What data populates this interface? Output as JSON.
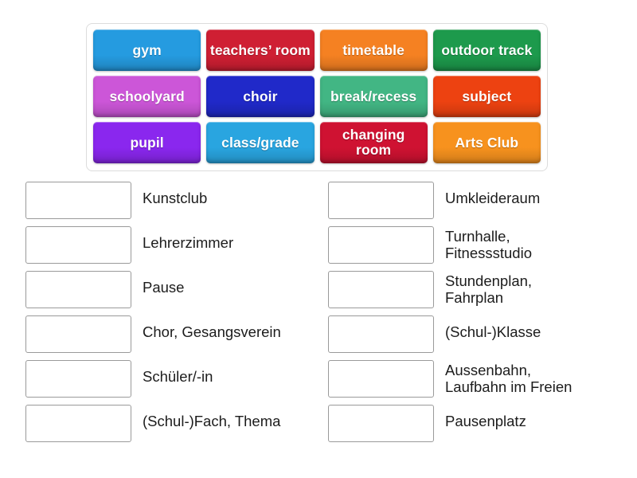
{
  "activity": {
    "type": "match-up",
    "title": "",
    "tile_rows": [
      [
        {
          "label": "gym",
          "color": "#259be0"
        },
        {
          "label": "teachers’\nroom",
          "color": "#cf1f33"
        },
        {
          "label": "timetable",
          "color": "#f58122"
        },
        {
          "label": "outdoor\ntrack",
          "color": "#1d9a4c"
        }
      ],
      [
        {
          "label": "schoolyard",
          "color": "#cc56d8"
        },
        {
          "label": "choir",
          "color": "#2029c9"
        },
        {
          "label": "break/recess",
          "color": "#42b684"
        },
        {
          "label": "subject",
          "color": "#ed4211"
        }
      ],
      [
        {
          "label": "pupil",
          "color": "#8a27ee"
        },
        {
          "label": "class/grade",
          "color": "#29a5e0"
        },
        {
          "label": "changing\nroom",
          "color": "#cf1232"
        },
        {
          "label": "Arts Club",
          "color": "#f7921e"
        }
      ]
    ],
    "answers_left": [
      {
        "label": "Kunstclub",
        "lines": 1,
        "box_value": ""
      },
      {
        "label": "Lehrerzimmer",
        "lines": 1,
        "box_value": ""
      },
      {
        "label": "Pause",
        "lines": 1,
        "box_value": ""
      },
      {
        "label": "Chor, Gesangsverein",
        "lines": 1,
        "box_value": ""
      },
      {
        "label": "Schüler/-in",
        "lines": 1,
        "box_value": ""
      },
      {
        "label": "(Schul-)Fach, Thema",
        "lines": 1,
        "box_value": ""
      }
    ],
    "answers_right": [
      {
        "label": "Umkleideraum",
        "lines": 1,
        "box_value": ""
      },
      {
        "label": "Turnhalle,\nFitnessstudio",
        "lines": 2,
        "box_value": ""
      },
      {
        "label": "Stundenplan,\nFahrplan",
        "lines": 2,
        "box_value": ""
      },
      {
        "label": "(Schul-)Klasse",
        "lines": 1,
        "box_value": ""
      },
      {
        "label": "Aussenbahn,\nLaufbahn im Freien",
        "lines": 2,
        "box_value": ""
      },
      {
        "label": "Pausenplatz",
        "lines": 1,
        "box_value": ""
      }
    ],
    "colors": {
      "page_background": "#ffffff",
      "bank_border": "#dcdcdc",
      "box_border": "#9a9a9a",
      "label_text": "#1c1c1c",
      "tile_text": "#ffffff"
    }
  }
}
